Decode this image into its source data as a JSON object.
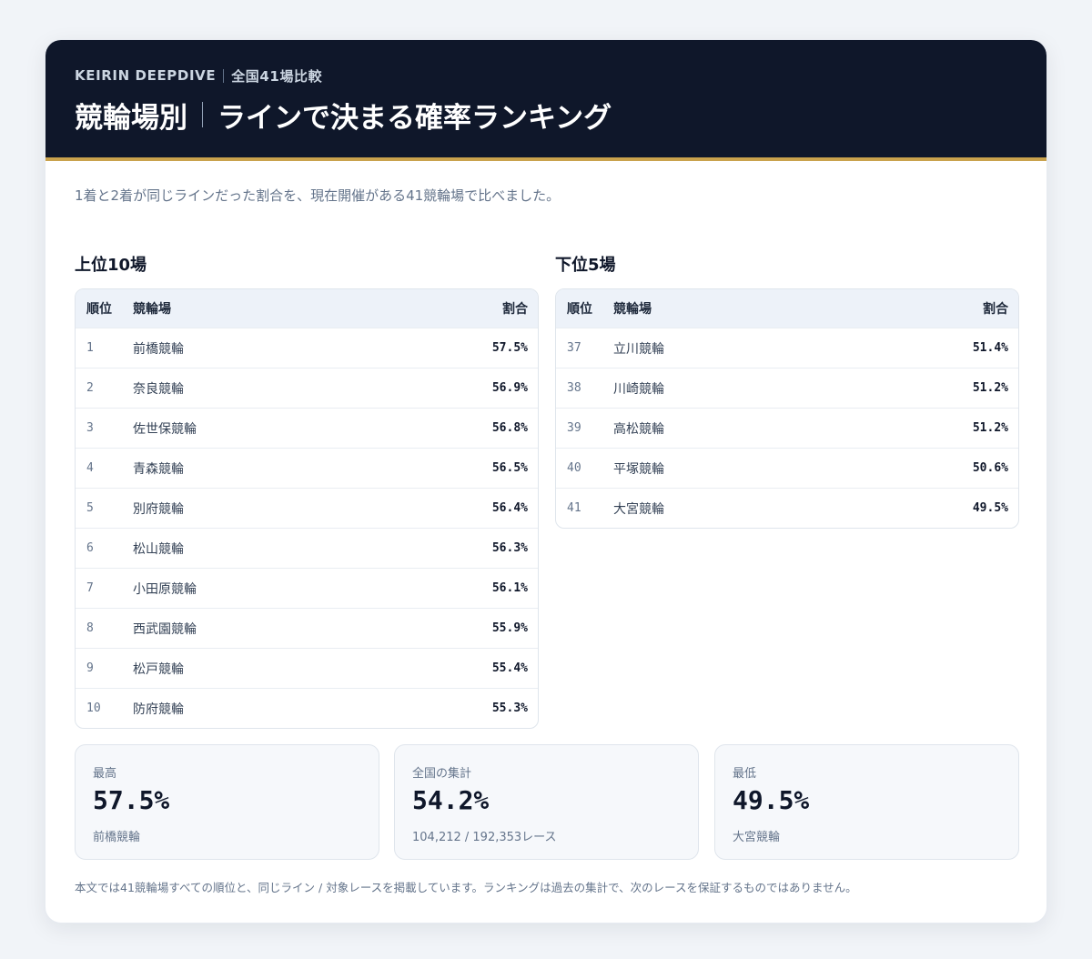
{
  "header": {
    "brand": "KEIRIN DEEPDIVE",
    "scope": "全国41場比較",
    "title_left": "競輪場別",
    "title_right": "ラインで決まる確率ランキング"
  },
  "lede": "1着と2着が同じラインだった割合を、現在開催がある41競輪場で比べました。",
  "columns": {
    "rank": "順位",
    "name": "競輪場",
    "pct": "割合"
  },
  "top": {
    "title": "上位10場",
    "rows": [
      {
        "rank": "1",
        "name": "前橋競輪",
        "pct": "57.5%"
      },
      {
        "rank": "2",
        "name": "奈良競輪",
        "pct": "56.9%"
      },
      {
        "rank": "3",
        "name": "佐世保競輪",
        "pct": "56.8%"
      },
      {
        "rank": "4",
        "name": "青森競輪",
        "pct": "56.5%"
      },
      {
        "rank": "5",
        "name": "別府競輪",
        "pct": "56.4%"
      },
      {
        "rank": "6",
        "name": "松山競輪",
        "pct": "56.3%"
      },
      {
        "rank": "7",
        "name": "小田原競輪",
        "pct": "56.1%"
      },
      {
        "rank": "8",
        "name": "西武園競輪",
        "pct": "55.9%"
      },
      {
        "rank": "9",
        "name": "松戸競輪",
        "pct": "55.4%"
      },
      {
        "rank": "10",
        "name": "防府競輪",
        "pct": "55.3%"
      }
    ]
  },
  "bottom": {
    "title": "下位5場",
    "rows": [
      {
        "rank": "37",
        "name": "立川競輪",
        "pct": "51.4%"
      },
      {
        "rank": "38",
        "name": "川崎競輪",
        "pct": "51.2%"
      },
      {
        "rank": "39",
        "name": "高松競輪",
        "pct": "51.2%"
      },
      {
        "rank": "40",
        "name": "平塚競輪",
        "pct": "50.6%"
      },
      {
        "rank": "41",
        "name": "大宮競輪",
        "pct": "49.5%"
      }
    ]
  },
  "stats": {
    "max": {
      "label": "最高",
      "value": "57.5%",
      "sub": "前橋競輪"
    },
    "total": {
      "label": "全国の集計",
      "value": "54.2%",
      "sub": "104,212 / 192,353レース"
    },
    "min": {
      "label": "最低",
      "value": "49.5%",
      "sub": "大宮競輪"
    }
  },
  "footnote": "本文では41競輪場すべての順位と、同じライン / 対象レースを掲載しています。ランキングは過去の集計で、次のレースを保証するものではありません。",
  "colors": {
    "header_bg": "#0f172a",
    "accent": "#c9a24d",
    "table_head_bg": "#edf2f9"
  }
}
